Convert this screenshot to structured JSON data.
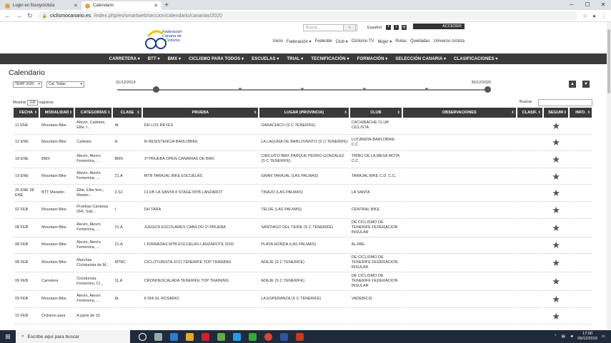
{
  "browser": {
    "tabs": [
      {
        "title": "Login en fissoyciclista",
        "active": false
      },
      {
        "title": "Calendario",
        "active": true
      }
    ],
    "url_domain": "ciclismocanario.es",
    "url_path": "/index.php/es/smartweb/seccion/calendario/canarias/2020"
  },
  "header": {
    "search_placeholder": "Buscar...",
    "search_button": "»",
    "language": "Español",
    "social": [
      "f",
      "t",
      "ig"
    ],
    "login_label": "ACCEDER",
    "logo_text": [
      "Federación",
      "Canaria de",
      "Ciclismo"
    ],
    "top_menu": [
      "Inicio",
      "Federación ▾",
      "Federáte",
      "Club ▾",
      "Ciclismo TV",
      "Mujer ▾",
      "Rutas",
      "Quedadas",
      "Universo ciclista"
    ]
  },
  "mainnav": [
    "CARRETERA ▾",
    "BTT ▾",
    "BMX ▾",
    "CICLISMO PARA TODOS ▾",
    "ESCUELAS ▾",
    "TRIAL ▾",
    "TECNIFICACIÓN ▾",
    "FORMACIÓN ▾",
    "SELECCIÓN CANARIA ▾",
    "CLASIFICACIONES ▾"
  ],
  "page": {
    "title": "Calendario",
    "season_select": "TEMP 2020",
    "category_select": "Cat. Todas",
    "date_from": "31/12/2019",
    "date_to": "30/12/2020",
    "show_label": "Mostrar",
    "show_count": "100",
    "show_suffix": "registros",
    "search_label": "Buscar:"
  },
  "table": {
    "headers": [
      "FECHA",
      "MODALIDAD",
      "CATEGORÍAS",
      "CLASE",
      "PRUEBA",
      "LUGAR (PROVINCIA)",
      "CLUB",
      "OBSERVACIONES",
      "CLASIF.",
      "SEGUIR",
      "INFO."
    ],
    "rows": [
      {
        "fecha": "11 ENE",
        "modalidad": "Mountain Bike",
        "categorias": "Alevín, Cadetes, Elite, I...",
        "clase": "IA",
        "prueba": "DH LOS REYES",
        "lugar": "GARACHICO (S C TENERIFE)",
        "club": "CACHIBACHE CLUB CICLISTA"
      },
      {
        "fecha": "12 ENE",
        "modalidad": "Mountain Bike",
        "categorias": "Cadetes",
        "clase": "H",
        "prueba": "III RESISTENCIA BARLOBIKE",
        "lugar": "LA LAGUNA DE BARLOVENTO (S C TENERIFE)",
        "club": "LUCANDIA-BARLOBIKE C.C"
      },
      {
        "fecha": "18 ENE",
        "modalidad": "BMX",
        "categorias": "Alevín, Alevín Femenina, ...",
        "clase": "BMX",
        "prueba": "1ª PRUEBA OPEN CANARIAS DE BMX",
        "lugar": "CIRCUITO BMX PARQUE PEDRO GONZALEZ (S C TENERIFE)",
        "club": "TRIBU DE LA MESA MOTA C.C"
      },
      {
        "fecha": "19 ENE",
        "modalidad": "Mountain Bike",
        "categorias": "Alevín, Alevín Femenina, ...",
        "clase": "21.A",
        "prueba": "MTB TARAJAL BIKE ESCUELAS",
        "lugar": "GRAN TARAJAL (LAS PALMAS)",
        "club": "TARAJAL BIKE C.D. C.C."
      },
      {
        "fecha": "25 ENE 28 ENE",
        "modalidad": "BTT Maratón",
        "categorias": "Elite, Elite fem., Master...",
        "clase": "2.S1",
        "prueba": "CLUB LA SANTA 4 STAGE MTB LANZAROT",
        "lugar": "TINAJO (LAS PALMAS)",
        "club": "LA SANTA"
      },
      {
        "fecha": "02 FEB",
        "modalidad": "Mountain Bike",
        "categorias": "Pruebas Canarias DHI, Sub...",
        "clase": "I",
        "prueba": "DH TARA",
        "lugar": "TELDE (LAS PALMAS)",
        "club": "CENTRAL BIKE"
      },
      {
        "fecha": "08 FEB",
        "modalidad": "Mountain Bike",
        "categorias": "Alevín, Alevín Femenina, ...",
        "clase": "21.A",
        "prueba": "JUEGOS ESCOLARES CABILDO 1ª PRUEBA",
        "lugar": "SANTIAGO DEL TEIDE (S C TENERIFE)",
        "club": "DE CICLISMO DE TENERIFE FEDERACION INSULAR"
      },
      {
        "fecha": "08 FEB",
        "modalidad": "Mountain Bike",
        "categorias": "Alevín, Alevín Femenina, ...",
        "clase": "21.A",
        "prueba": "I JORNADAS MTB ESCUELAS LANZAROTE 2020",
        "lugar": "PLAYA HONDA (LAS PALMAS)",
        "club": "ALJIBE"
      },
      {
        "fecha": "08 FEB",
        "modalidad": "Mountain Bike",
        "categorias": "Marchas Cicloturista de M...",
        "clase": "MTBC",
        "prueba": "CICLOTURISTA XCO TENERIFE TOP TRAINING",
        "lugar": "ADEJE (S C TENERIFE)",
        "club": "DE CICLISMO DE TENERIFE FEDERACION INSULAR"
      },
      {
        "fecha": "09 FEB",
        "modalidad": "Carretera",
        "categorias": "Cicloturista Femenino, Cl...",
        "clase": "11.A",
        "prueba": "CRONOESCALADA TENERIFE TOP TRAINING",
        "lugar": "ADEJE (S C TENERIFE)",
        "club": "DE CICLISMO DE TENERIFE FEDERACION INSULAR"
      },
      {
        "fecha": "09 FEB",
        "modalidad": "Mountain Bike",
        "categorias": "Alevín, Alevín Femenina, ...",
        "clase": "IA",
        "prueba": "II DHI EL ROSARIO",
        "lugar": "LA ESPERANZA (S C TENERIFE)",
        "club": "VADEBICIS"
      },
      {
        "fecha": "15 FEB",
        "modalidad": "Ciclismo para",
        "categorias": "A partir de 15",
        "clase": "",
        "prueba": "",
        "lugar": "",
        "club": ""
      }
    ]
  },
  "taskbar": {
    "search_placeholder": "Escribe aquí para buscar",
    "time": "17:00",
    "date": "06/12/2019"
  },
  "colors": {
    "nav_bg": "#3a3a3a",
    "taskbar_bg": "#1f2a3a"
  }
}
